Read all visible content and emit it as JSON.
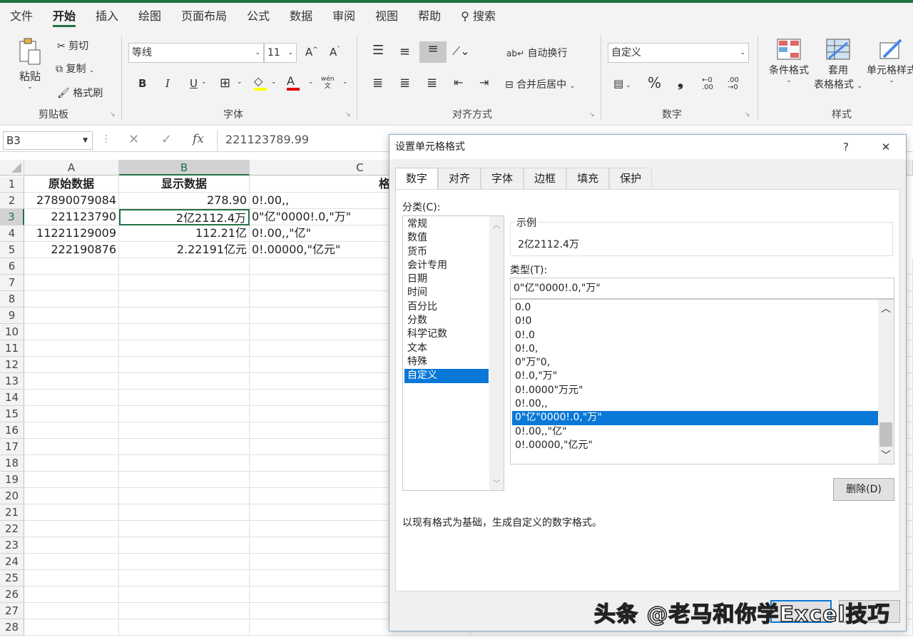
{
  "menu": {
    "items": [
      "文件",
      "开始",
      "插入",
      "绘图",
      "页面布局",
      "公式",
      "数据",
      "审阅",
      "视图",
      "帮助"
    ],
    "search": "搜索"
  },
  "ribbon": {
    "clipboard": {
      "paste": "粘贴",
      "cut": "剪切",
      "copy": "复制",
      "format_painter": "格式刷",
      "label": "剪贴板"
    },
    "font": {
      "name": "等线",
      "size": "11",
      "bold": "B",
      "italic": "I",
      "underline": "U",
      "phonetic": "wén",
      "label": "字体"
    },
    "alignment": {
      "wrap": "自动换行",
      "merge": "合并后居中",
      "label": "对齐方式"
    },
    "number": {
      "format": "自定义",
      "percent": "%",
      "comma": "❟",
      "label": "数字"
    },
    "styles": {
      "conditional": "条件格式",
      "table_line1": "套用",
      "table_line2": "表格格式",
      "cell_styles": "单元格样式",
      "label": "样式"
    }
  },
  "formula_bar": {
    "name_box": "B3",
    "fx": "fx",
    "value": "221123789.99"
  },
  "sheet": {
    "columns": [
      "A",
      "B",
      "C"
    ],
    "rows": [
      "1",
      "2",
      "3",
      "4",
      "5",
      "6",
      "7",
      "8",
      "9",
      "10",
      "11",
      "12",
      "13",
      "14",
      "15",
      "16",
      "17",
      "18",
      "19",
      "20",
      "21",
      "22",
      "23",
      "24",
      "25",
      "26",
      "27",
      "28"
    ],
    "header": {
      "a": "原始数据",
      "b": "显示数据",
      "c": "格式代码"
    },
    "data": [
      {
        "a": "27890079084",
        "b": "278.90",
        "c": "0!.00,,"
      },
      {
        "a": "221123790",
        "b": "2亿2112.4万",
        "c": "0\"亿\"0000!.0,\"万\""
      },
      {
        "a": "11221129009",
        "b": "112.21亿",
        "c": "0!.00,,\"亿\""
      },
      {
        "a": "222190876",
        "b": "2.22191亿元",
        "c": "0!.00000,\"亿元\""
      }
    ]
  },
  "dialog": {
    "title": "设置单元格格式",
    "help": "?",
    "close": "✕",
    "tabs": [
      "数字",
      "对齐",
      "字体",
      "边框",
      "填充",
      "保护"
    ],
    "category_label": "分类(C):",
    "categories": [
      "常规",
      "数值",
      "货币",
      "会计专用",
      "日期",
      "时间",
      "百分比",
      "分数",
      "科学记数",
      "文本",
      "特殊",
      "自定义"
    ],
    "selected_category": "自定义",
    "sample_label": "示例",
    "sample_value": "2亿2112.4万",
    "type_label": "类型(T):",
    "type_value": "0\"亿\"0000!.0,\"万\"",
    "type_list": [
      "0.0",
      "0!0",
      "0!.0",
      "0!.0,",
      "0\"万\"0,",
      "0!.0,\"万\"",
      "0!.0000\"万元\"",
      "0!.00,,",
      "0\"亿\"0000!.0,\"万\"",
      "0!.00,,\"亿\"",
      "0!.00000,\"亿元\""
    ],
    "selected_type": "0\"亿\"0000!.0,\"万\"",
    "delete_button": "删除(D)",
    "description": "以现有格式为基础，生成自定义的数字格式。"
  },
  "watermark": "头条 @老马和你学Excel技巧"
}
